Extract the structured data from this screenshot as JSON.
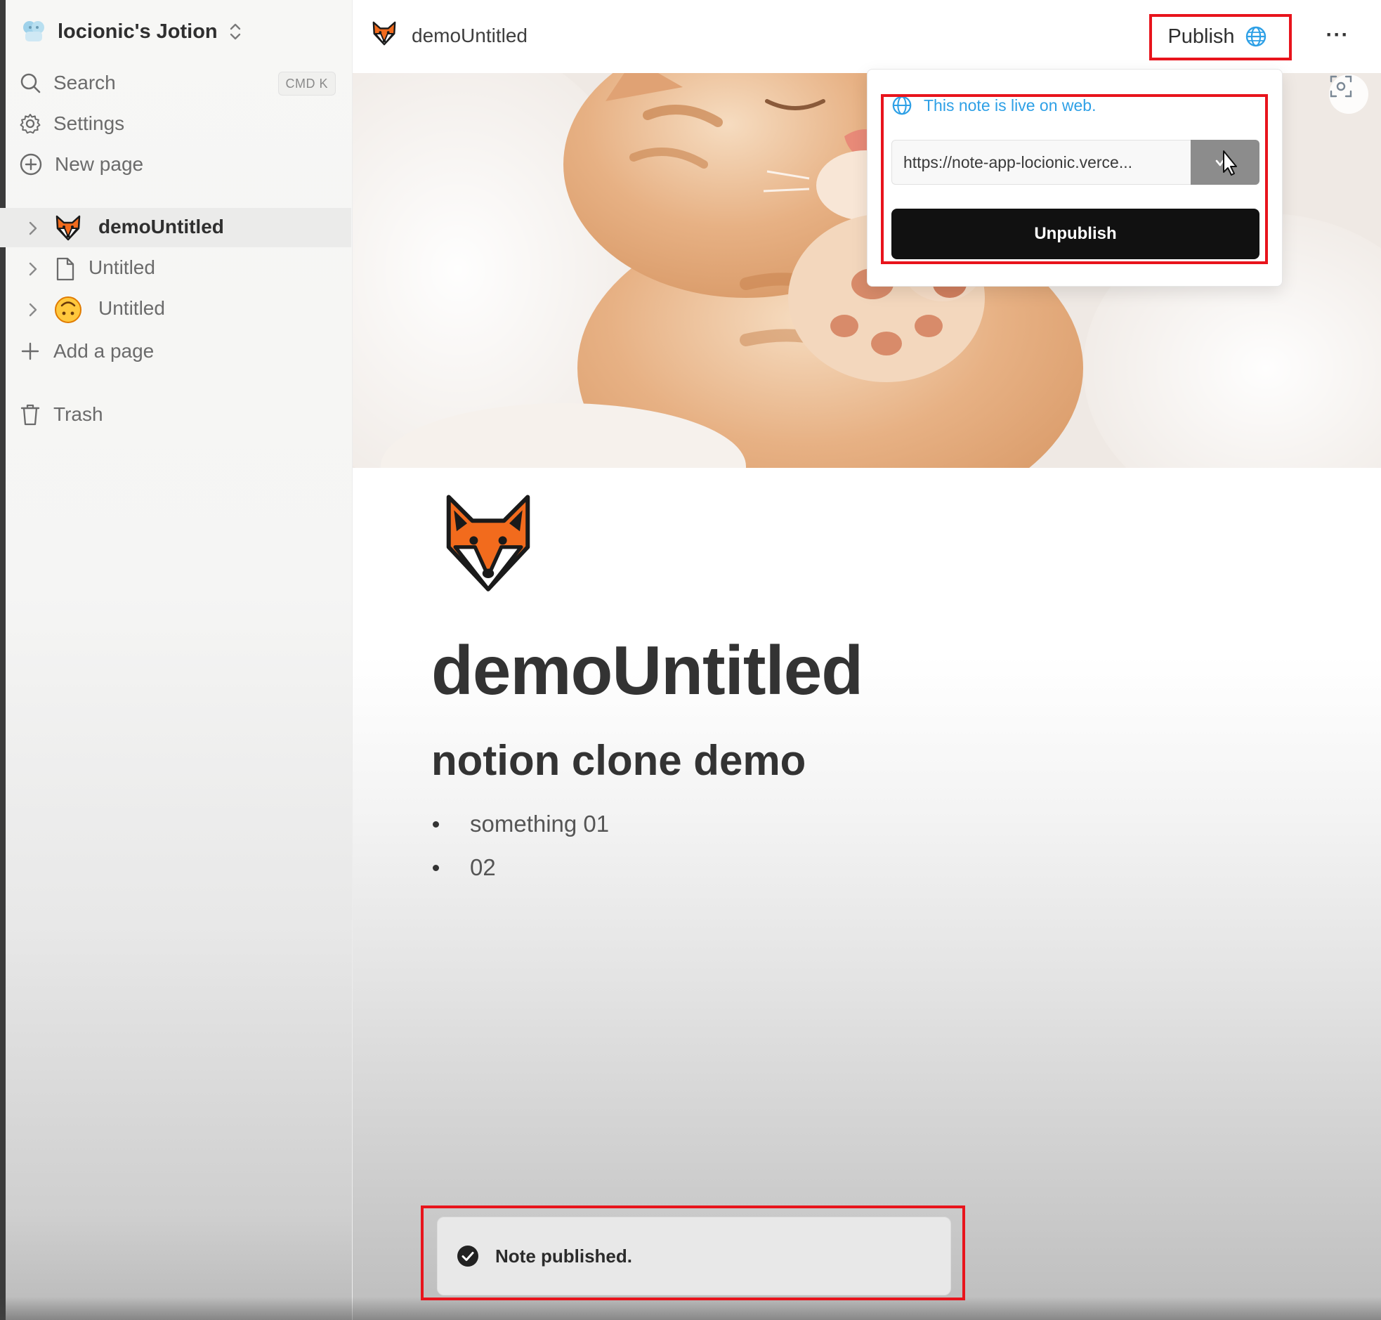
{
  "sidebar": {
    "workspace_name": "locionic's Jotion",
    "search_label": "Search",
    "search_shortcut": "CMD K",
    "settings_label": "Settings",
    "new_page_label": "New page",
    "pages": [
      {
        "label": "demoUntitled",
        "icon": "fox-emoji-icon",
        "active": true
      },
      {
        "label": "Untitled",
        "icon": "document-icon",
        "active": false
      },
      {
        "label": "Untitled",
        "icon": "upside-down-face-emoji-icon",
        "active": false
      }
    ],
    "add_page_label": "Add a page",
    "trash_label": "Trash"
  },
  "topbar": {
    "page_title": "demoUntitled",
    "publish_label": "Publish",
    "more_label": "···"
  },
  "publish_popover": {
    "live_text": "This note is live on web.",
    "url": "https://note-app-locionic.verce...",
    "unpublish_label": "Unpublish"
  },
  "document": {
    "title": "demoUntitled",
    "heading": "notion clone demo",
    "bullets": [
      "something 01",
      "02"
    ]
  },
  "toast": {
    "message": "Note published."
  },
  "colors": {
    "accent_blue": "#2ea0e6",
    "highlight_red": "#e8141c",
    "button_dark": "#111111"
  }
}
